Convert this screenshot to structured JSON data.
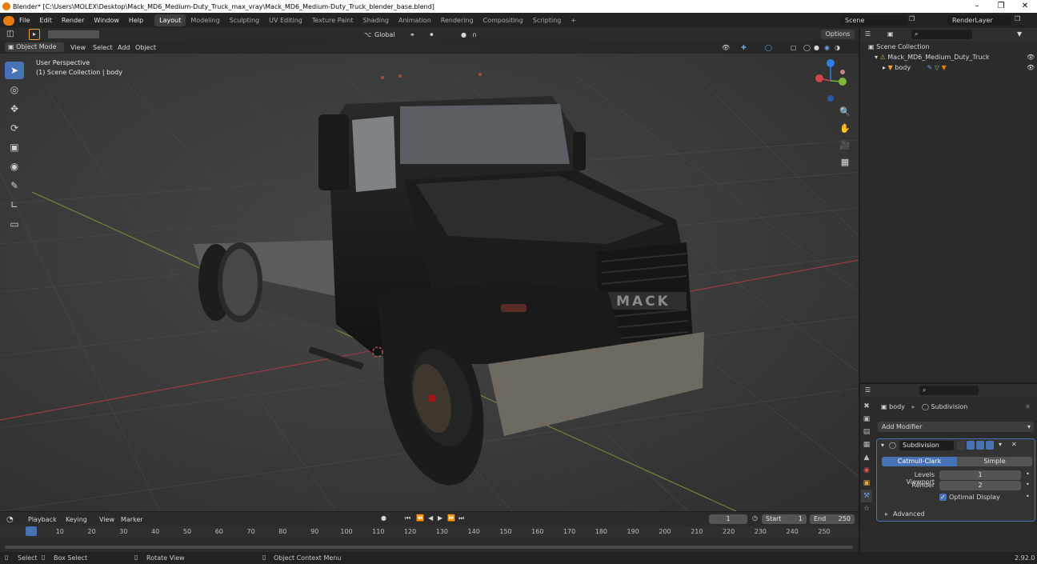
{
  "window": {
    "title": "Blender* [C:\\Users\\MOLEX\\Desktop\\Mack_MD6_Medium-Duty_Truck_max_vray\\Mack_MD6_Medium-Duty_Truck_blender_base.blend]"
  },
  "menu": {
    "items": [
      "File",
      "Edit",
      "Render",
      "Window",
      "Help"
    ],
    "workspaces": [
      "Layout",
      "Modeling",
      "Sculpting",
      "UV Editing",
      "Texture Paint",
      "Shading",
      "Animation",
      "Rendering",
      "Compositing",
      "Scripting"
    ],
    "active_workspace": "Layout",
    "scene": "Scene",
    "render_layer": "RenderLayer"
  },
  "viewport": {
    "transform_orientation": "Global",
    "options_label": "Options",
    "mode": "Object Mode",
    "header_menus": [
      "View",
      "Select",
      "Add",
      "Object"
    ],
    "overlay_title": "User Perspective",
    "overlay_subtitle": "(1) Scene Collection | body",
    "truck_brand": "MACK"
  },
  "timeline": {
    "menus": [
      "Playback",
      "Keying",
      "View",
      "Marker"
    ],
    "current_frame": "1",
    "start_label": "Start",
    "start_value": "1",
    "end_label": "End",
    "end_value": "250",
    "ruler": [
      "1",
      "10",
      "20",
      "30",
      "40",
      "50",
      "60",
      "70",
      "80",
      "90",
      "100",
      "110",
      "120",
      "130",
      "140",
      "150",
      "160",
      "170",
      "180",
      "190",
      "200",
      "210",
      "220",
      "230",
      "240",
      "250"
    ]
  },
  "statusbar": {
    "select": "Select",
    "box_select": "Box Select",
    "rotate_view": "Rotate View",
    "context_menu": "Object Context Menu",
    "version": "2.92.0"
  },
  "outliner": {
    "root": "Scene Collection",
    "collection": "Mack_MD6_Medium_Duty_Truck",
    "object": "body"
  },
  "properties": {
    "object_name": "body",
    "modifier_breadcrumb": "Subdivision",
    "add_modifier": "Add Modifier",
    "modifier_name": "Subdivision",
    "type_catmull": "Catmull-Clark",
    "type_simple": "Simple",
    "levels_viewport_label": "Levels Viewport",
    "levels_viewport_value": "1",
    "render_label": "Render",
    "render_value": "2",
    "optimal_display": "Optimal Display",
    "advanced": "Advanced"
  },
  "colors": {
    "accent": "#4772b3",
    "viewport_bg": "#3a3a3a",
    "panel_bg": "#2b2b2b",
    "axis_x": "#d2404e",
    "axis_y": "#7ab83a",
    "axis_z": "#2f7fe6"
  }
}
